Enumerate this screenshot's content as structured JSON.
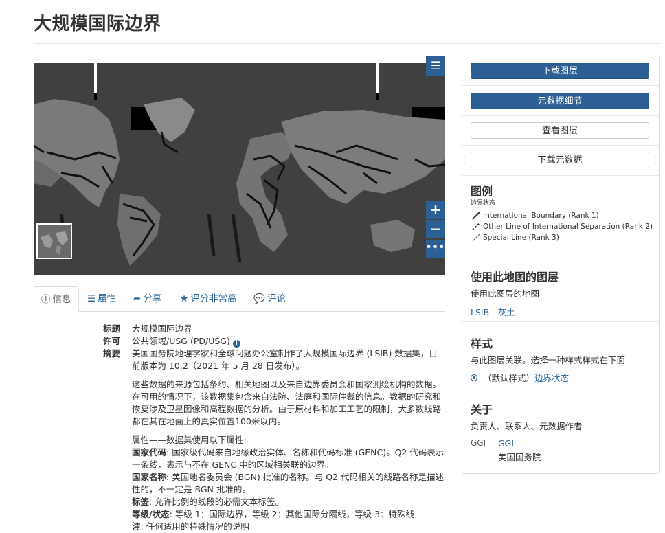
{
  "page": {
    "title": "大规模国际边界"
  },
  "map": {
    "menu_icon": "hamburger-menu-icon",
    "zoom_in": "+",
    "zoom_out": "−",
    "more": "•••"
  },
  "tabs": [
    {
      "icon": "info-circle-icon",
      "label": "信息"
    },
    {
      "icon": "list-icon",
      "label": "属性"
    },
    {
      "icon": "share-icon",
      "label": "分享"
    },
    {
      "icon": "star-icon",
      "label": "评分非常高"
    },
    {
      "icon": "comment-icon",
      "label": "评论"
    }
  ],
  "info": {
    "title_label": "标题",
    "title_value": "大规模国际边界",
    "license_label": "许可",
    "license_value": "公共领域/USG (PD/USG)",
    "abstract_label": "摘要",
    "abstract_p1": "美国国务院地理学家和全球问题办公室制作了大规模国际边界 (LSIB) 数据集，目前版本为 10.2（2021 年 5 月 28 日发布）。",
    "abstract_p2": "这些数据的来源包括条约、相关地图以及来自边界委员会和国家测绘机构的数据。在可用的情况下，该数据集包含来自法院、法庭和国际仲裁的信息。数据的研究和恢复涉及卫星图像和高程数据的分析。由于原材料和加工工艺的限制，大多数线路都在其在地面上的真实位置100米以内。",
    "attr_intro": "属性——数据集使用以下属性:",
    "attr_cc_label": "国家代码",
    "attr_cc_text": ": 国家级代码来自地缘政治实体、名称和代码标准 (GENC)。Q2 代码表示一条线，表示与不在 GENC 中的区域相关联的边界。",
    "attr_cn_label": "国家名称",
    "attr_cn_text": ": 美国地名委员会 (BGN) 批准的名称。与 Q2 代码相关的线路名称是描述性的，不一定是 BGN 批准的。",
    "attr_label_label": "标签",
    "attr_label_text": ": 允许比例的线段的必需文本标签。",
    "attr_rank_label": "等级/状态",
    "attr_rank_text": ": 等级 1：国际边界，等级 2：其他国际分隔线，等级 3：特殊线",
    "attr_note_label": "注",
    "attr_note_text": ": 任何适用的特殊情况的说明"
  },
  "sidebar": {
    "download_layer": "下载图层",
    "metadata_detail": "元数据细节",
    "view_layer": "查看图层",
    "download_metadata": "下载元数据",
    "legend_title": "图例",
    "legend_subtitle": "边界状态",
    "legend_items": [
      "International Boundary (Rank 1)",
      "Other Line of International Separation (Rank 2)",
      "Special Line (Rank 3)"
    ],
    "maps_title": "使用此地图的图层",
    "maps_text": "使用此图层的地图",
    "maps_link": "LSIB - 灰土",
    "styles_title": "样式",
    "styles_text": "与此图层关联。选择一种样式样式在下面",
    "style_default": "（默认样式）",
    "style_link": "边界状态",
    "about_title": "关于",
    "about_text": "负责人、联系人、元数据作者",
    "org_img_alt": "GGI",
    "org_name": "GGI",
    "org_sub": "美国国务院"
  },
  "colors": {
    "primary": "#2c5f93",
    "link": "#2a6496",
    "map_bg": "#3a3a3a"
  }
}
